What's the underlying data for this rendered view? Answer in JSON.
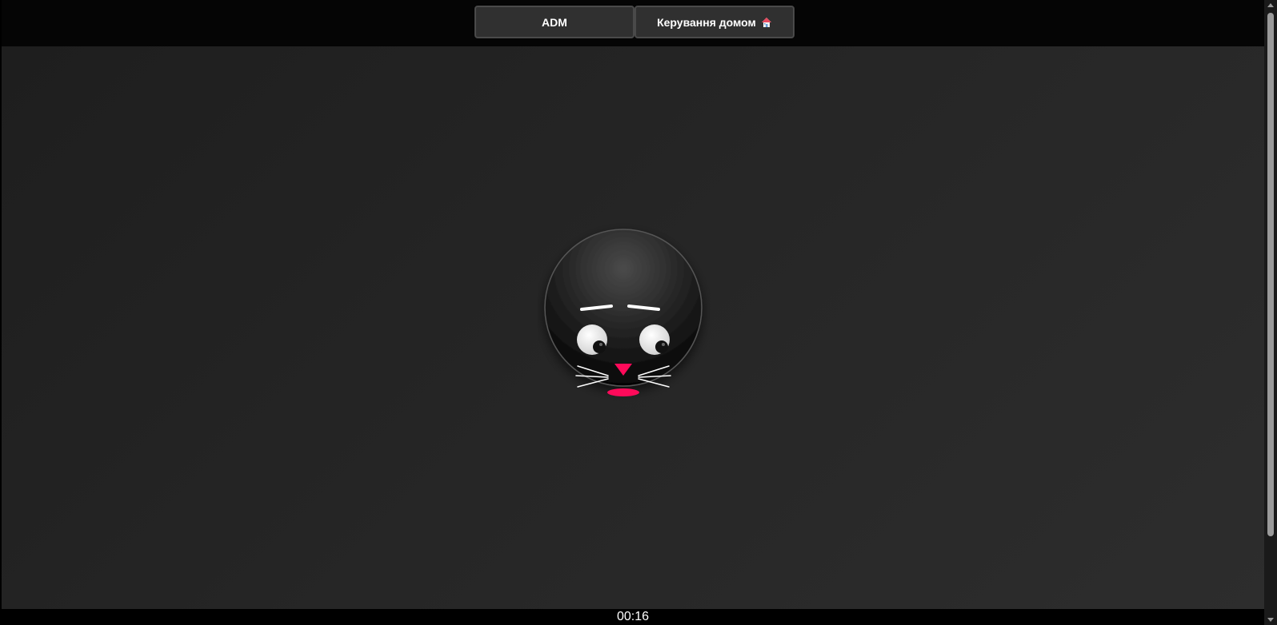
{
  "nav": {
    "adm_label": "ADM",
    "home_label": "Керування домом",
    "home_icon": "house-icon"
  },
  "timer": {
    "value": "00:16"
  },
  "theme": {
    "background": "#242424",
    "topbar": "#050505",
    "button_bg": "#303030",
    "button_border": "#4a4a4a",
    "nose_mouth": "#ff0a5a"
  }
}
